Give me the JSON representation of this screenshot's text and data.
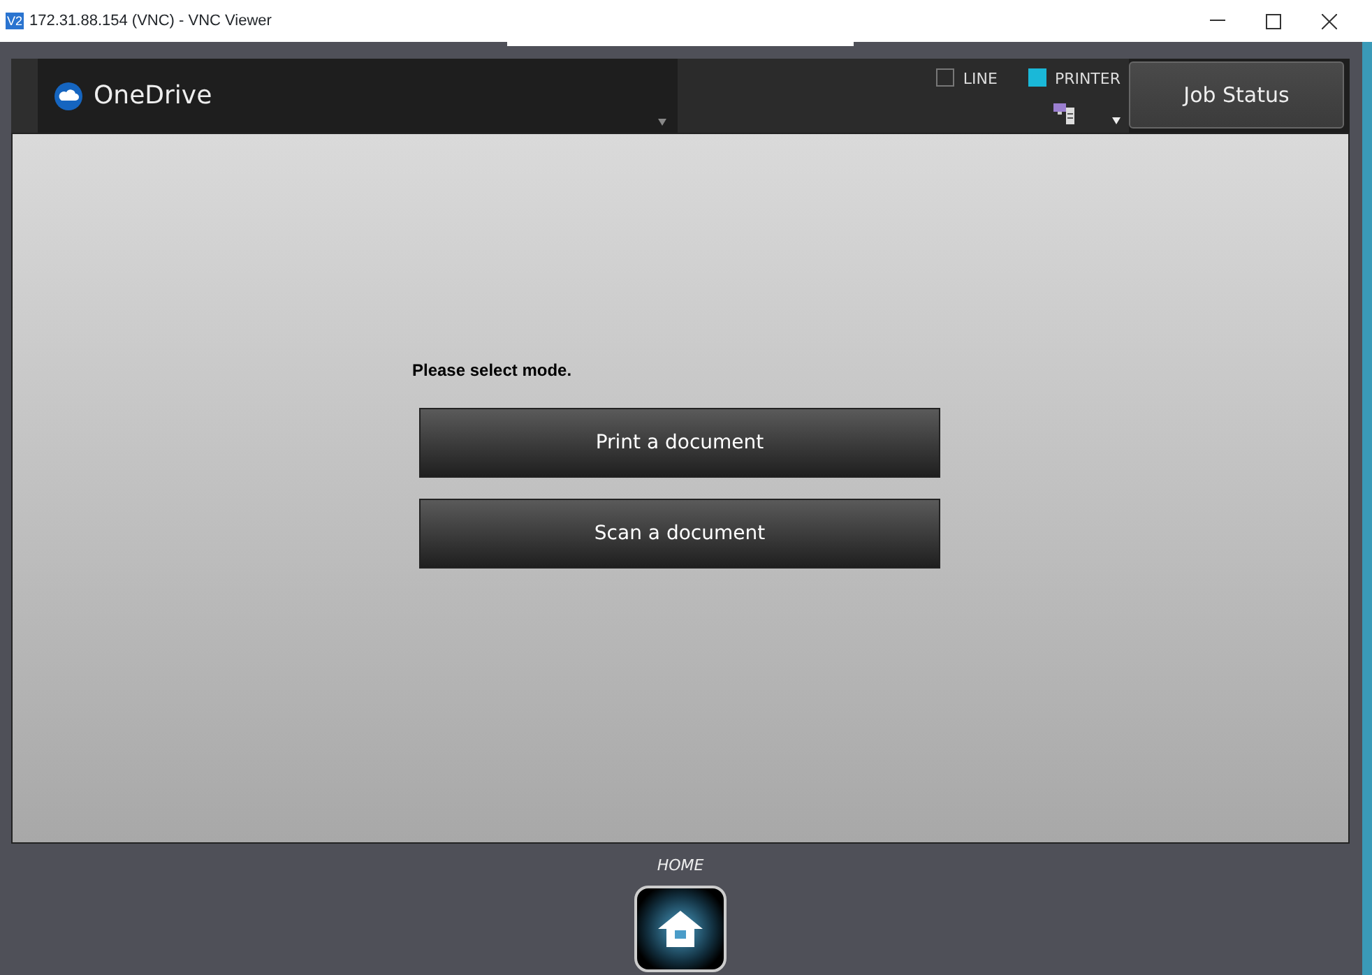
{
  "window": {
    "title": "172.31.88.154 (VNC) - VNC Viewer",
    "app_badge": "V2"
  },
  "header": {
    "app_name": "OneDrive",
    "indicators": [
      {
        "label": "LINE",
        "on": false
      },
      {
        "label": "PRINTER",
        "on": true
      }
    ],
    "job_status_button": "Job Status"
  },
  "main": {
    "prompt": "Please select mode.",
    "buttons": [
      "Print a document",
      "Scan a document"
    ]
  },
  "footer": {
    "home_label": "HOME"
  }
}
